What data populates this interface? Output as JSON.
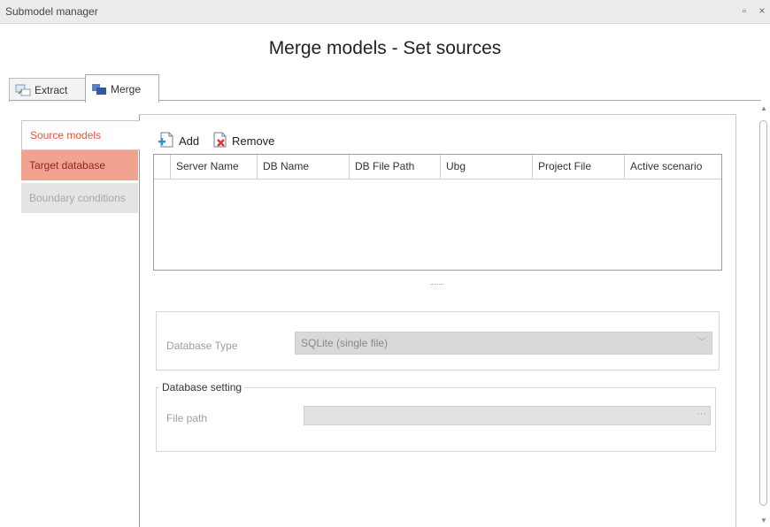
{
  "window": {
    "title": "Submodel manager",
    "maximize_glyph": "▫",
    "close_glyph": "×"
  },
  "header": {
    "title": "Merge models - Set sources"
  },
  "tabs": [
    {
      "label": "Extract",
      "icon": "extract-icon"
    },
    {
      "label": "Merge",
      "icon": "merge-icon"
    }
  ],
  "sidebar": {
    "items": [
      {
        "label": "Source models",
        "state": "selected"
      },
      {
        "label": "Target database",
        "state": "error"
      },
      {
        "label": "Boundary conditions",
        "state": "disabled"
      }
    ]
  },
  "toolbar": {
    "add_label": "Add",
    "remove_label": "Remove"
  },
  "grid": {
    "columns": [
      "Server Name",
      "DB Name",
      "DB File Path",
      "Ubg",
      "Project File",
      "Active scenario"
    ],
    "rows": []
  },
  "splitter_glyph": "·····",
  "database": {
    "type_label": "Database Type",
    "type_value": "SQLite (single file)",
    "dropdown_glyph": "﹀"
  },
  "database_setting": {
    "group_title": "Database setting",
    "file_path_label": "File path",
    "file_path_value": "",
    "browse_glyph": "···"
  },
  "colors": {
    "selected_text": "#e0553a",
    "error_bg": "#f1a291",
    "disabled_bg": "#e4e4e4"
  }
}
